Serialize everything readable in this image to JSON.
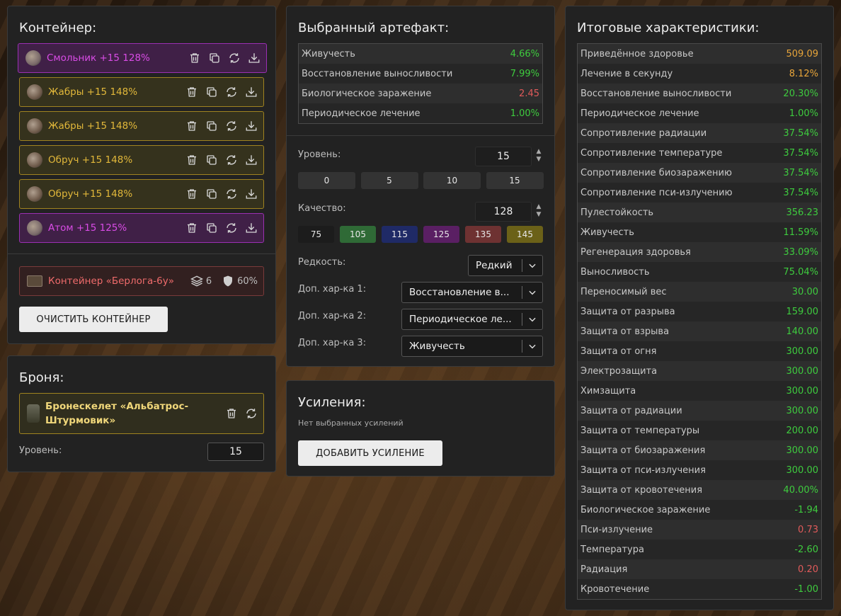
{
  "container": {
    "title": "Контейнер:",
    "items": [
      {
        "name": "Смольник +15 128%",
        "rarity": "purple"
      },
      {
        "name": "Жабры +15 148%",
        "rarity": "gold"
      },
      {
        "name": "Жабры +15 148%",
        "rarity": "gold"
      },
      {
        "name": "Обруч +15 148%",
        "rarity": "gold"
      },
      {
        "name": "Обруч +15 148%",
        "rarity": "gold"
      },
      {
        "name": "Атом +15 125%",
        "rarity": "purple"
      }
    ],
    "container_name": "Контейнер «Берлога-6у»",
    "slots": "6",
    "protection": "60%",
    "clear_button": "ОЧИСТИТЬ КОНТЕЙНЕР"
  },
  "armor": {
    "title": "Броня:",
    "name": "Бронескелет «Альбатрос-Штурмовик»",
    "level_label": "Уровень:",
    "level_value": "15"
  },
  "artifact": {
    "title": "Выбранный артефакт:",
    "stats": [
      {
        "label": "Живучесть",
        "value": "4.66%",
        "color": "green"
      },
      {
        "label": "Восстановление выносливости",
        "value": "7.99%",
        "color": "green"
      },
      {
        "label": "Биологическое заражение",
        "value": "2.45",
        "color": "red"
      },
      {
        "label": "Периодическое лечение",
        "value": "1.00%",
        "color": "green"
      }
    ],
    "level_label": "Уровень:",
    "level_value": "15",
    "level_presets": [
      "0",
      "5",
      "10",
      "15"
    ],
    "quality_label": "Качество:",
    "quality_value": "128",
    "quality_presets": [
      {
        "label": "75",
        "color": "#1c1c1c"
      },
      {
        "label": "105",
        "color": "#2f6a36"
      },
      {
        "label": "115",
        "color": "#1f2a66"
      },
      {
        "label": "125",
        "color": "#5a1f63"
      },
      {
        "label": "135",
        "color": "#6e3232"
      },
      {
        "label": "145",
        "color": "#6b6118"
      }
    ],
    "rarity_label": "Редкость:",
    "rarity_value": "Редкий",
    "extra1_label": "Доп. хар-ка 1:",
    "extra1_value": "Восстановление в...",
    "extra2_label": "Доп. хар-ка 2:",
    "extra2_value": "Периодическое ле...",
    "extra3_label": "Доп. хар-ка 3:",
    "extra3_value": "Живучесть"
  },
  "boosts": {
    "title": "Усиления:",
    "empty_text": "Нет выбранных усилений",
    "add_button": "ДОБАВИТЬ УСИЛЕНИЕ"
  },
  "totals": {
    "title": "Итоговые характеристики:",
    "stats": [
      {
        "label": "Приведённое здоровье",
        "value": "509.09",
        "color": "orange"
      },
      {
        "label": "Лечение в секунду",
        "value": "8.12%",
        "color": "orange"
      },
      {
        "label": "Восстановление выносливости",
        "value": "20.30%",
        "color": "green"
      },
      {
        "label": "Периодическое лечение",
        "value": "1.00%",
        "color": "green"
      },
      {
        "label": "Сопротивление радиации",
        "value": "37.54%",
        "color": "green"
      },
      {
        "label": "Сопротивление температуре",
        "value": "37.54%",
        "color": "green"
      },
      {
        "label": "Сопротивление биозаражению",
        "value": "37.54%",
        "color": "green"
      },
      {
        "label": "Сопротивление пси-излучению",
        "value": "37.54%",
        "color": "green"
      },
      {
        "label": "Пулестойкость",
        "value": "356.23",
        "color": "green"
      },
      {
        "label": "Живучесть",
        "value": "11.59%",
        "color": "green"
      },
      {
        "label": "Регенерация здоровья",
        "value": "33.09%",
        "color": "green"
      },
      {
        "label": "Выносливость",
        "value": "75.04%",
        "color": "green"
      },
      {
        "label": "Переносимый вес",
        "value": "30.00",
        "color": "green"
      },
      {
        "label": "Защита от разрыва",
        "value": "159.00",
        "color": "green"
      },
      {
        "label": "Защита от взрыва",
        "value": "140.00",
        "color": "green"
      },
      {
        "label": "Защита от огня",
        "value": "300.00",
        "color": "green"
      },
      {
        "label": "Электрозащита",
        "value": "300.00",
        "color": "green"
      },
      {
        "label": "Химзащита",
        "value": "300.00",
        "color": "green"
      },
      {
        "label": "Защита от радиации",
        "value": "300.00",
        "color": "green"
      },
      {
        "label": "Защита от температуры",
        "value": "200.00",
        "color": "green"
      },
      {
        "label": "Защита от биозаражения",
        "value": "300.00",
        "color": "green"
      },
      {
        "label": "Защита от пси-излучения",
        "value": "300.00",
        "color": "green"
      },
      {
        "label": "Защита от кровотечения",
        "value": "40.00%",
        "color": "green"
      },
      {
        "label": "Биологическое заражение",
        "value": "-1.94",
        "color": "green"
      },
      {
        "label": "Пси-излучение",
        "value": "0.73",
        "color": "red"
      },
      {
        "label": "Температура",
        "value": "-2.60",
        "color": "green"
      },
      {
        "label": "Радиация",
        "value": "0.20",
        "color": "red"
      },
      {
        "label": "Кровотечение",
        "value": "-1.00",
        "color": "green"
      }
    ]
  }
}
